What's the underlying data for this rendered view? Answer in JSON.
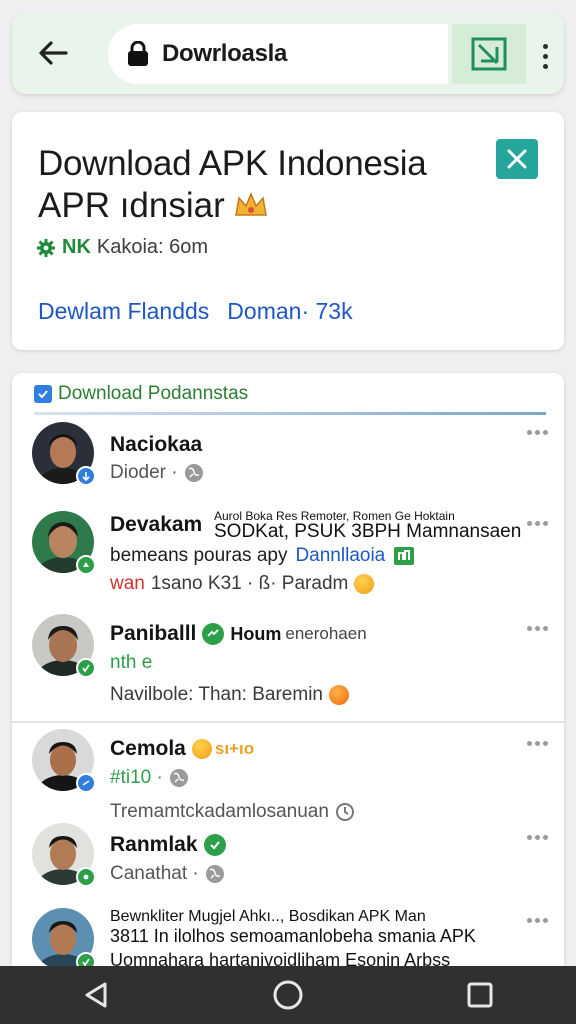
{
  "topbar": {
    "url": "Dowrloasla",
    "icons": [
      "back-arrow-icon",
      "lock-icon",
      "external-view-icon",
      "overflow-menu-icon"
    ]
  },
  "header": {
    "title": "Download APK Indonesia",
    "subtitle": "APR ıdnsiar",
    "meta_strong": "NK",
    "meta_text": "Kakoia: 6om",
    "link_1": "Dewlam Flandds",
    "link_2": "Doman· 73k",
    "close_color": "#26a69a"
  },
  "feed": {
    "heading": "Download Podannstas",
    "posts": [
      {
        "name": "Naciokaa",
        "line_1": "Dioder ·",
        "badge_color": "#2f7ee0"
      },
      {
        "name": "Devakam",
        "name_suffix": "Aurol Boka Res Remoter, Romen Ge Hoktain",
        "name_suffix_2": "SODKat, PSUK 3BPH Mamnansaen",
        "line_1": "bemeans pouras apy",
        "line_1_link": "Dannllaoia",
        "line_2_red": "wan",
        "line_2": "1sano K31 · ß· Paradm",
        "badge_color": "#2e9f49"
      },
      {
        "name": "Paniballl",
        "name_suffix_bold": "Houm",
        "name_suffix": "enerohaen",
        "line_1": "nth e",
        "line_2": "Navilbole: Than: Baremin",
        "badge_color": "#2e9f49"
      },
      {
        "name": "Cemola",
        "name_suffix": "sı+ıo",
        "line_1": "#ti10 ·",
        "line_2": "Tremamtckadamlosanuan",
        "badge_color": "#2f7ee0"
      },
      {
        "name": "Ranmlak",
        "line_1": "Canathat ·",
        "badge_color": "#2e9f49"
      },
      {
        "line_1": "Bewnkliter Mugjel Ahkı.., Bosdikan APK Man",
        "line_2": "3811 In ilolhos semoamanlobeha smania APK",
        "line_3": "Uomnahara hartanivoidliham Esonin Arbss",
        "badge_color": "#2e9f49"
      }
    ]
  },
  "navbar": {
    "icons": [
      "back-triangle-icon",
      "home-circle-icon",
      "recents-square-icon"
    ]
  }
}
